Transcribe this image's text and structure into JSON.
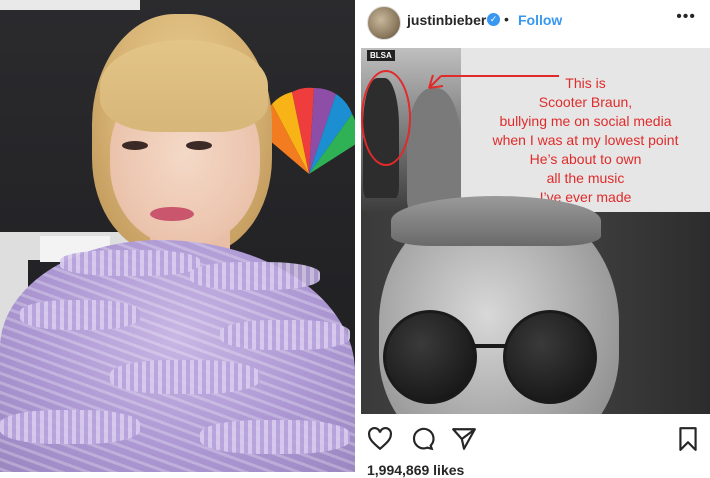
{
  "post": {
    "username": "justinbieber",
    "verified_icon": "verified-badge-icon",
    "separator": "•",
    "follow_label": "Follow",
    "more_icon": "•••",
    "inset_sign": "BLSA",
    "caption_lines": [
      "This is",
      "Scooter Braun,",
      "bullying me on social media",
      "when I was at my lowest point",
      "He’s about to own",
      "all the music",
      "I’ve ever made"
    ],
    "likes": "1,994,869 likes"
  },
  "colors": {
    "accent": "#3897f0",
    "annotation": "#e02b2b",
    "text": "#262626"
  },
  "icons": {
    "like": "heart-icon",
    "comment": "comment-icon",
    "share": "share-icon",
    "save": "bookmark-icon"
  }
}
